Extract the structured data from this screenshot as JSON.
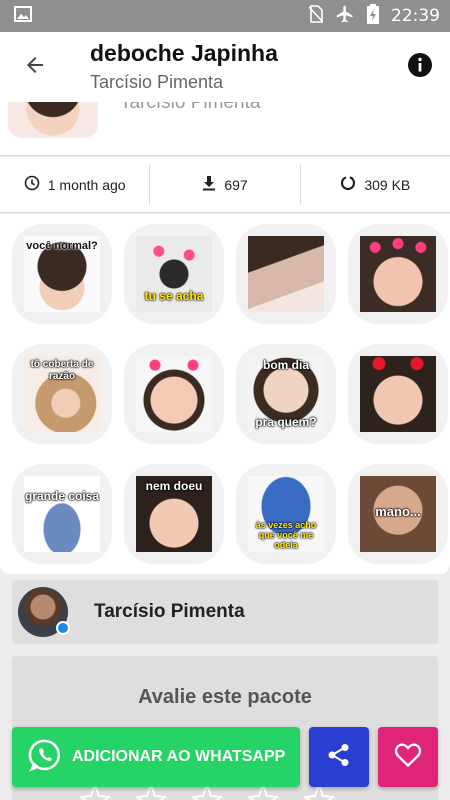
{
  "status_bar": {
    "time": "22:39",
    "icons": [
      "image-icon",
      "no-sim-icon",
      "airplane-icon",
      "battery-charging-icon"
    ]
  },
  "toolbar": {
    "title": "deboche Japinha",
    "author": "Tarcísio Pimenta",
    "back_icon": "arrow-back-icon",
    "info_icon": "info-icon"
  },
  "header_remnant": {
    "author": "Tarcísio Pimenta"
  },
  "stats": {
    "updated": "1 month ago",
    "downloads": "697",
    "size": "309 KB"
  },
  "stickers": [
    {
      "text": "você normal?"
    },
    {
      "text": "tu se acha"
    },
    {
      "text": ""
    },
    {
      "text": ""
    },
    {
      "text": "tô coberta de razão"
    },
    {
      "text": ""
    },
    {
      "text_top": "bom dia",
      "text_bottom": "pra quem?"
    },
    {
      "text": ""
    },
    {
      "text": "grande coisa"
    },
    {
      "text": "nem doeu"
    },
    {
      "text": "às vezes acho que você me odeia"
    },
    {
      "text": "mano..."
    }
  ],
  "author_card": {
    "name": "Tarcísio Pimenta"
  },
  "rate_card": {
    "title": "Avalie este pacote"
  },
  "actions": {
    "whatsapp_label": "ADICIONAR AO WHATSAPP"
  },
  "colors": {
    "whatsapp": "#25d366",
    "share": "#2a3fd1",
    "favorite": "#e0247a",
    "status_bar": "#8f8f8f"
  }
}
